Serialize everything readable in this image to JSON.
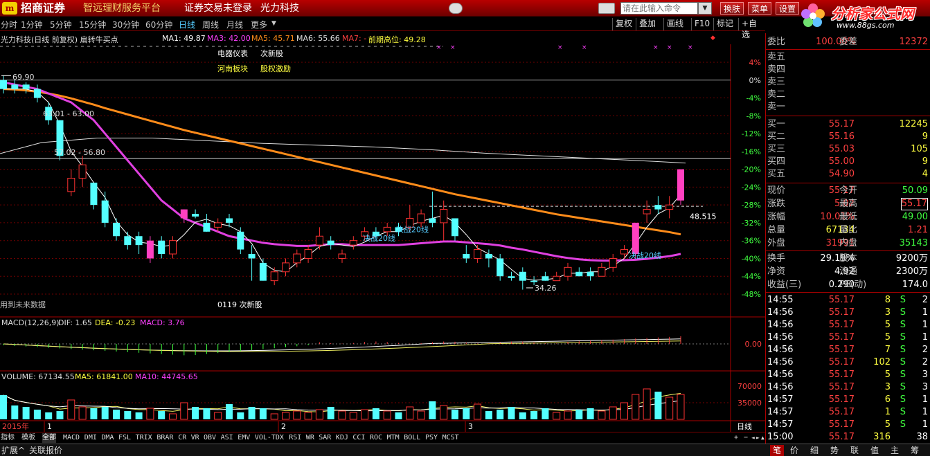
{
  "titlebar": {
    "logo_mark": "m",
    "app_name": "招商证券",
    "app_sub": "智远理财服务平台",
    "login_status": "证券交易未登录",
    "stock_name": "光力科技",
    "cmd_placeholder": "请在此输入命令",
    "buttons": [
      "换肤",
      "菜单",
      "设置"
    ]
  },
  "brand": {
    "name": "分析家公式网",
    "url": "www.88gs.com"
  },
  "periods": [
    "分时",
    "1分钟",
    "5分钟",
    "15分钟",
    "30分钟",
    "60分钟",
    "日线",
    "周线",
    "月线",
    "更多"
  ],
  "active_period": "日线",
  "right_buttons": [
    "复权",
    "叠加",
    "画线",
    "F10",
    "标记",
    "+自选"
  ],
  "infoline": {
    "stock": "光力科技(日线 前复权) 扁转牛买点",
    "ma1": "MA1: 49.87",
    "ma3": "MA3: 42.00",
    "ma5": "MA5: 45.71",
    "ma6": "MA6: 55.66",
    "ma7": "MA7: -",
    "prev_high": "前期高位: 49.28"
  },
  "chart_labels": {
    "sector1": "电器仪表",
    "sector2": "次新股",
    "sector3": "河南板块",
    "sector4": "股权激励",
    "future_note": "用到未来数据",
    "date_note": "0119 次新股",
    "price_high": "69.90",
    "range1": "63.01 - 63.00",
    "range2": "57.02 - 56.80",
    "price_low": "34.26",
    "price_mark": "48.515",
    "ann1": "决战20线",
    "ann2": "决战20线",
    "ann3": "决战20线"
  },
  "pct_axis": [
    "4%",
    "0%",
    "-4%",
    "-8%",
    "-12%",
    "-16%",
    "-20%",
    "-24%",
    "-28%",
    "-32%",
    "-36%",
    "-40%",
    "-44%",
    "-48%"
  ],
  "macd": {
    "label": "MACD(12,26,9)",
    "dif": "DIF: 1.65",
    "dea": "DEA: -0.23",
    "macd": "MACD: 3.76",
    "axis": "0.00"
  },
  "volume": {
    "label": "VOLUME: 67134.55",
    "ma5": "MA5: 61841.00",
    "ma10": "MA10: 44745.65",
    "axis_hi": "70000",
    "axis_lo": "35000"
  },
  "date_axis": {
    "year": "2015年",
    "m1": "1",
    "m2": "2",
    "m3": "3",
    "period_btn": "日线"
  },
  "colors": {
    "up": "#ff3232",
    "down": "#54ffff",
    "ma_orange": "#ff8c1a",
    "ma_magenta": "#e040e0",
    "ma_white": "#e0e0e0",
    "ma_yellow": "#f0f060"
  },
  "chart_data": {
    "type": "candlestick",
    "y_axis_percent": [
      -48,
      4
    ],
    "candles": [
      {
        "o": 0,
        "c": -2,
        "h": 1,
        "l": -3,
        "up": false
      },
      {
        "o": -1,
        "c": -2,
        "h": 0,
        "l": -3,
        "up": false
      },
      {
        "o": -1,
        "c": -2,
        "h": -0.5,
        "l": -3,
        "up": false
      },
      {
        "o": -2,
        "c": -4,
        "h": -1,
        "l": -5,
        "up": false
      },
      {
        "o": -6,
        "c": -9,
        "h": -5,
        "l": -10,
        "up": false
      },
      {
        "o": -9,
        "c": -17,
        "h": -9,
        "l": -18,
        "up": false
      },
      {
        "o": -25,
        "c": -22,
        "h": -20,
        "l": -26,
        "up": true
      },
      {
        "o": -22,
        "c": -19,
        "h": -17,
        "l": -24,
        "up": true
      },
      {
        "o": -23,
        "c": -28,
        "h": -23,
        "l": -29,
        "up": false
      },
      {
        "o": -27,
        "c": -32,
        "h": -25,
        "l": -33,
        "up": false
      },
      {
        "o": -32,
        "c": -35,
        "h": -31,
        "l": -36,
        "up": false
      },
      {
        "o": -35,
        "c": -37,
        "h": -34,
        "l": -38,
        "up": false
      },
      {
        "o": -35,
        "c": -37,
        "h": -34,
        "l": -39,
        "up": false
      },
      {
        "o": -40,
        "c": -36,
        "h": -35,
        "l": -41,
        "up": true
      },
      {
        "o": -36,
        "c": -39,
        "h": -35,
        "l": -40,
        "up": false
      },
      {
        "o": -39,
        "c": -36,
        "h": -35,
        "l": -40,
        "up": true
      },
      {
        "o": -31,
        "c": -29,
        "h": -29,
        "l": -32,
        "up": true
      },
      {
        "o": -30,
        "c": -30.6,
        "h": -29,
        "l": -31,
        "up": false
      },
      {
        "o": -32,
        "c": -34,
        "h": -30,
        "l": -34,
        "up": false
      },
      {
        "o": -33,
        "c": -32,
        "h": -31,
        "l": -34,
        "up": true
      },
      {
        "o": -31,
        "c": -32,
        "h": -30,
        "l": -33,
        "up": false
      },
      {
        "o": -34,
        "c": -38,
        "h": -33,
        "l": -39,
        "up": false
      },
      {
        "o": -39,
        "c": -40,
        "h": -37,
        "l": -45,
        "up": false
      },
      {
        "o": -41,
        "c": -45,
        "h": -40,
        "l": -45,
        "up": false
      },
      {
        "o": -45,
        "c": -43,
        "h": -42,
        "l": -46,
        "up": true
      },
      {
        "o": -43,
        "c": -41,
        "h": -40,
        "l": -44,
        "up": true
      },
      {
        "o": -41,
        "c": -39,
        "h": -38,
        "l": -42,
        "up": true
      },
      {
        "o": -40,
        "c": -38,
        "h": -37,
        "l": -41,
        "up": true
      },
      {
        "o": -37,
        "c": -35,
        "h": -33,
        "l": -38,
        "up": true
      },
      {
        "o": -36,
        "c": -37,
        "h": -35,
        "l": -38,
        "up": false
      },
      {
        "o": -40,
        "c": -39,
        "h": -38,
        "l": -41,
        "up": true
      },
      {
        "o": -37,
        "c": -36,
        "h": -35,
        "l": -38,
        "up": true
      },
      {
        "o": -35,
        "c": -34,
        "h": -33,
        "l": -36,
        "up": true
      },
      {
        "o": -34,
        "c": -35,
        "h": -33,
        "l": -36,
        "up": false
      },
      {
        "o": -34,
        "c": -33,
        "h": -32,
        "l": -35,
        "up": true
      },
      {
        "o": -33,
        "c": -34,
        "h": -32,
        "l": -35,
        "up": false
      },
      {
        "o": -33,
        "c": -31,
        "h": -28,
        "l": -34,
        "up": true
      },
      {
        "o": -32,
        "c": -30,
        "h": -29,
        "l": -33,
        "up": true
      },
      {
        "o": -31,
        "c": -32,
        "h": -25,
        "l": -33,
        "up": false
      },
      {
        "o": -32,
        "c": -29,
        "h": -27,
        "l": -36,
        "up": true
      },
      {
        "o": -31,
        "c": -35,
        "h": -31,
        "l": -36,
        "up": false
      },
      {
        "o": -39,
        "c": -40,
        "h": -37,
        "l": -41,
        "up": false
      },
      {
        "o": -40,
        "c": -38,
        "h": -37,
        "l": -41,
        "up": true
      },
      {
        "o": -40,
        "c": -39,
        "h": -38,
        "l": -42,
        "up": false
      },
      {
        "o": -40,
        "c": -44,
        "h": -39,
        "l": -45,
        "up": false
      },
      {
        "o": -44,
        "c": -44.4,
        "h": -43,
        "l": -45,
        "up": false
      },
      {
        "o": -43,
        "c": -45,
        "h": -42,
        "l": -47,
        "up": false
      },
      {
        "o": -45,
        "c": -45.3,
        "h": -44,
        "l": -46,
        "up": false
      },
      {
        "o": -45,
        "c": -44,
        "h": -43,
        "l": -45,
        "up": false
      },
      {
        "o": -45,
        "c": -44,
        "h": -43,
        "l": -45,
        "up": true
      },
      {
        "o": -44,
        "c": -42,
        "h": -41,
        "l": -45,
        "up": true
      },
      {
        "o": -43,
        "c": -44,
        "h": -42,
        "l": -44,
        "up": false
      },
      {
        "o": -44,
        "c": -43,
        "h": -42,
        "l": -45,
        "up": false
      },
      {
        "o": -44,
        "c": -42,
        "h": -41,
        "l": -44,
        "up": true
      },
      {
        "o": -42,
        "c": -40,
        "h": -39,
        "l": -43,
        "up": true
      },
      {
        "o": -39,
        "c": -38,
        "h": -37,
        "l": -40,
        "up": true
      },
      {
        "o": -39,
        "c": -32,
        "h": -32,
        "l": -40,
        "up": true
      },
      {
        "o": -30,
        "c": -29,
        "h": -27,
        "l": -32,
        "up": true
      },
      {
        "o": -28,
        "c": -29,
        "h": -26,
        "l": -30,
        "up": false
      },
      {
        "o": -29,
        "c": -28,
        "h": -26,
        "l": -31,
        "up": true
      },
      {
        "o": -27,
        "c": -20,
        "h": -20,
        "l": -28,
        "up": true
      }
    ],
    "ma_orange": [
      -2.0,
      -2.1,
      -2.3,
      -2.6,
      -3.0,
      -3.5,
      -4.1,
      -4.8,
      -5.5,
      -6.3,
      -7.0,
      -7.7,
      -8.4,
      -9.1,
      -9.8,
      -10.5,
      -11.2,
      -11.8,
      -12.4,
      -13.0,
      -13.6,
      -14.2,
      -14.8,
      -15.4,
      -16.0,
      -16.6,
      -17.2,
      -17.8,
      -18.4,
      -19.0,
      -19.6,
      -20.2,
      -20.8,
      -21.4,
      -22.0,
      -22.6,
      -23.2,
      -23.8,
      -24.4,
      -25.0,
      -25.6,
      -26.1,
      -26.6,
      -27.1,
      -27.6,
      -28.1,
      -28.6,
      -29.1,
      -29.6,
      -30.1,
      -30.5,
      -30.9,
      -31.3,
      -31.7,
      -32.1,
      -32.5,
      -32.9,
      -33.3,
      -33.7,
      -34.1,
      -34.6
    ],
    "ma_magenta": [
      -0.5,
      -1,
      -1.5,
      -2,
      -3,
      -4,
      -5,
      -7,
      -9,
      -12,
      -15,
      -18,
      -21,
      -24,
      -27,
      -29,
      -31,
      -32,
      -33,
      -34,
      -35,
      -35.5,
      -36,
      -36.5,
      -36.8,
      -37,
      -37.2,
      -37.2,
      -37,
      -36.8,
      -36.8,
      -37,
      -37,
      -37,
      -37,
      -37,
      -36.8,
      -36.6,
      -36.4,
      -36.2,
      -36.2,
      -36.4,
      -36.6,
      -36.8,
      -37.1,
      -37.6,
      -38.0,
      -38.5,
      -39.0,
      -39.5,
      -39.9,
      -40.2,
      -40.4,
      -40.5,
      -40.5,
      -40.4,
      -40.3,
      -40.1,
      -39.8,
      -39.5,
      -39.0
    ]
  },
  "orderbook": {
    "weibi_label": "委比",
    "weibi": "100.00%",
    "weicha_label": "委差",
    "weicha": "12372",
    "asks": [
      {
        "label": "卖五",
        "price": "",
        "vol": ""
      },
      {
        "label": "卖四",
        "price": "",
        "vol": ""
      },
      {
        "label": "卖三",
        "price": "",
        "vol": ""
      },
      {
        "label": "卖二",
        "price": "",
        "vol": ""
      },
      {
        "label": "卖一",
        "price": "",
        "vol": ""
      }
    ],
    "bids": [
      {
        "label": "买一",
        "price": "55.17",
        "vol": "12245"
      },
      {
        "label": "买二",
        "price": "55.16",
        "vol": "9"
      },
      {
        "label": "买三",
        "price": "55.03",
        "vol": "105"
      },
      {
        "label": "买四",
        "price": "55.00",
        "vol": "9"
      },
      {
        "label": "买五",
        "price": "54.90",
        "vol": "4"
      }
    ]
  },
  "quote": [
    {
      "l1": "现价",
      "v1": "55.17",
      "l2": "今开",
      "v2": "50.09"
    },
    {
      "l1": "涨跌",
      "v1": "5.02",
      "l2": "最高",
      "v2": "55.17"
    },
    {
      "l1": "涨幅",
      "v1": "10.01%",
      "l2": "最低",
      "v2": "49.00"
    },
    {
      "l1": "总量",
      "v1": "67134",
      "l2": "量比",
      "v2": "1.21"
    },
    {
      "l1": "外盘",
      "v1": "31991",
      "l2": "内盘",
      "v2": "35143"
    }
  ],
  "quote2": [
    {
      "l1": "换手",
      "v1": "29.19%",
      "l2": "股本",
      "v2": "9200万"
    },
    {
      "l1": "净资",
      "v1": "4.92",
      "l2": "流通",
      "v2": "2300万"
    },
    {
      "l1": "收益(三)",
      "v1": "0.290",
      "l2": "PE(动)",
      "v2": "174.0"
    }
  ],
  "ticks": [
    {
      "t": "14:55",
      "p": "55.17",
      "v": "8",
      "s": "S",
      "n": "2"
    },
    {
      "t": "14:56",
      "p": "55.17",
      "v": "3",
      "s": "S",
      "n": "1"
    },
    {
      "t": "14:56",
      "p": "55.17",
      "v": "5",
      "s": "S",
      "n": "1"
    },
    {
      "t": "14:56",
      "p": "55.17",
      "v": "5",
      "s": "S",
      "n": "1"
    },
    {
      "t": "14:56",
      "p": "55.17",
      "v": "7",
      "s": "S",
      "n": "2"
    },
    {
      "t": "14:56",
      "p": "55.17",
      "v": "102",
      "s": "S",
      "n": "2"
    },
    {
      "t": "14:56",
      "p": "55.17",
      "v": "5",
      "s": "S",
      "n": "3"
    },
    {
      "t": "14:56",
      "p": "55.17",
      "v": "3",
      "s": "S",
      "n": "3"
    },
    {
      "t": "14:57",
      "p": "55.17",
      "v": "6",
      "s": "S",
      "n": "1"
    },
    {
      "t": "14:57",
      "p": "55.17",
      "v": "1",
      "s": "S",
      "n": "1"
    },
    {
      "t": "14:57",
      "p": "55.17",
      "v": "5",
      "s": "S",
      "n": "1"
    },
    {
      "t": "15:00",
      "p": "55.17",
      "v": "316",
      "s": "",
      "n": "38"
    }
  ],
  "ind_tabs": [
    "指标",
    "模板",
    "全部",
    "MACD",
    "DMI",
    "DMA",
    "FSL",
    "TRIX",
    "BRAR",
    "CR",
    "VR",
    "OBV",
    "ASI",
    "EMV",
    "VOL-TDX",
    "RSI",
    "WR",
    "SAR",
    "KDJ",
    "CCI",
    "ROC",
    "MTM",
    "BOLL",
    "PSY",
    "MCST"
  ],
  "active_ind_tab": "全部",
  "bottom_left": [
    "扩展^",
    "关联报价"
  ],
  "bottom_right": [
    "笔",
    "价",
    "细",
    "势",
    "联",
    "值",
    "主",
    "筹"
  ]
}
